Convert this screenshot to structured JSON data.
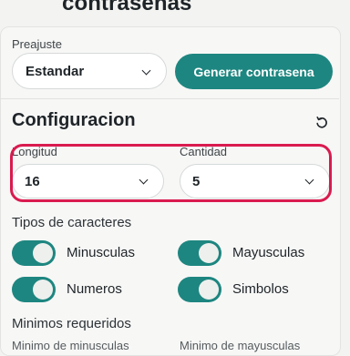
{
  "header": {
    "title": "contrasenas"
  },
  "preset": {
    "label": "Preajuste",
    "value": "Estandar"
  },
  "generate": {
    "label": "Generar contrasena"
  },
  "config": {
    "title": "Configuracion",
    "reset_icon": "refresh-icon"
  },
  "length": {
    "label": "Longitud",
    "value": "16"
  },
  "quantity": {
    "label": "Cantidad",
    "value": "5"
  },
  "char_types": {
    "title": "Tipos de caracteres",
    "lowercase": {
      "label": "Minusculas",
      "on": true
    },
    "uppercase": {
      "label": "Mayusculas",
      "on": true
    },
    "numbers": {
      "label": "Numeros",
      "on": true
    },
    "symbols": {
      "label": "Simbolos",
      "on": true
    }
  },
  "minimums": {
    "title": "Minimos requeridos",
    "col1_label": "Minimo de minusculas",
    "col2_label": "Minimo de mayusculas"
  },
  "colors": {
    "accent": "#1e8680",
    "highlight": "#d91b4f"
  }
}
